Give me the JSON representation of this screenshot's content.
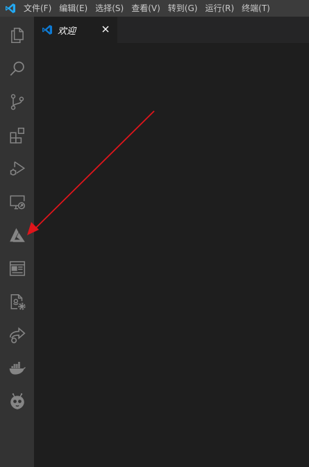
{
  "menu": {
    "items": [
      "文件(F)",
      "编辑(E)",
      "选择(S)",
      "查看(V)",
      "转到(G)",
      "运行(R)",
      "终端(T)"
    ]
  },
  "activity_bar": {
    "icons": [
      "explorer-icon",
      "search-icon",
      "source-control-icon",
      "extensions-icon",
      "run-debug-icon",
      "remote-explorer-icon",
      "azure-icon",
      "browser-preview-icon",
      "file-settings-icon",
      "live-share-icon",
      "docker-icon",
      "platformio-icon"
    ]
  },
  "tabs": [
    {
      "label": "欢迎",
      "active": true
    }
  ],
  "colors": {
    "titlebar": "#3c3c3c",
    "activitybar": "#333333",
    "editor": "#1e1e1e",
    "tabs_background": "#252526",
    "vscode_blue": "#0e7ad3",
    "annotation_arrow": "#e0151b"
  }
}
